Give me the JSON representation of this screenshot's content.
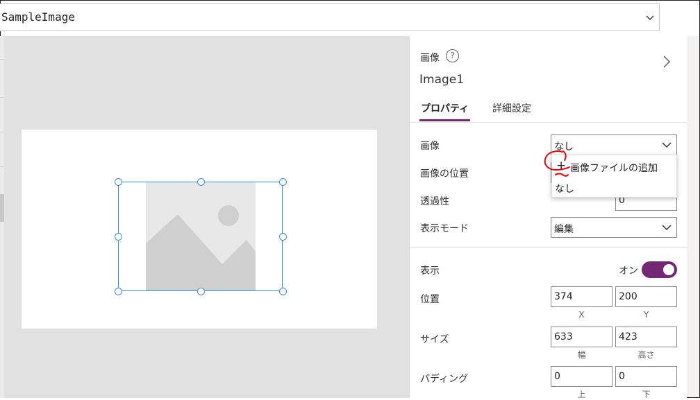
{
  "formula_bar": {
    "value": "SampleImage"
  },
  "properties_pane": {
    "control_type": "画像",
    "help_glyph": "?",
    "control_name": "Image1",
    "tabs": [
      {
        "label": "プロパティ",
        "active": true
      },
      {
        "label": "詳細設定",
        "active": false
      }
    ],
    "image": {
      "label": "画像",
      "selected": "なし"
    },
    "image_position": {
      "label": "画像の位置"
    },
    "transparency": {
      "label": "透過性",
      "value": "0"
    },
    "display_mode": {
      "label": "表示モード",
      "selected": "編集"
    },
    "visible": {
      "label": "表示",
      "toggle_text": "オン",
      "on": true
    },
    "position": {
      "label": "位置",
      "x": "374",
      "y": "200",
      "x_label": "X",
      "y_label": "Y"
    },
    "size": {
      "label": "サイズ",
      "width": "633",
      "height": "423",
      "width_label": "幅",
      "height_label": "高さ"
    },
    "padding": {
      "label": "パディング",
      "top": "0",
      "bottom": "0",
      "top_label": "上",
      "bottom_label": "下"
    }
  },
  "image_flyout": {
    "items": [
      {
        "icon": "plus-icon",
        "label": "画像ファイルの追加"
      },
      {
        "label": "なし"
      }
    ]
  },
  "colors": {
    "accent": "#742774",
    "selection": "#3b8ad8",
    "annotation": "#e8000b",
    "canvas_bg": "#e1e1e1"
  }
}
